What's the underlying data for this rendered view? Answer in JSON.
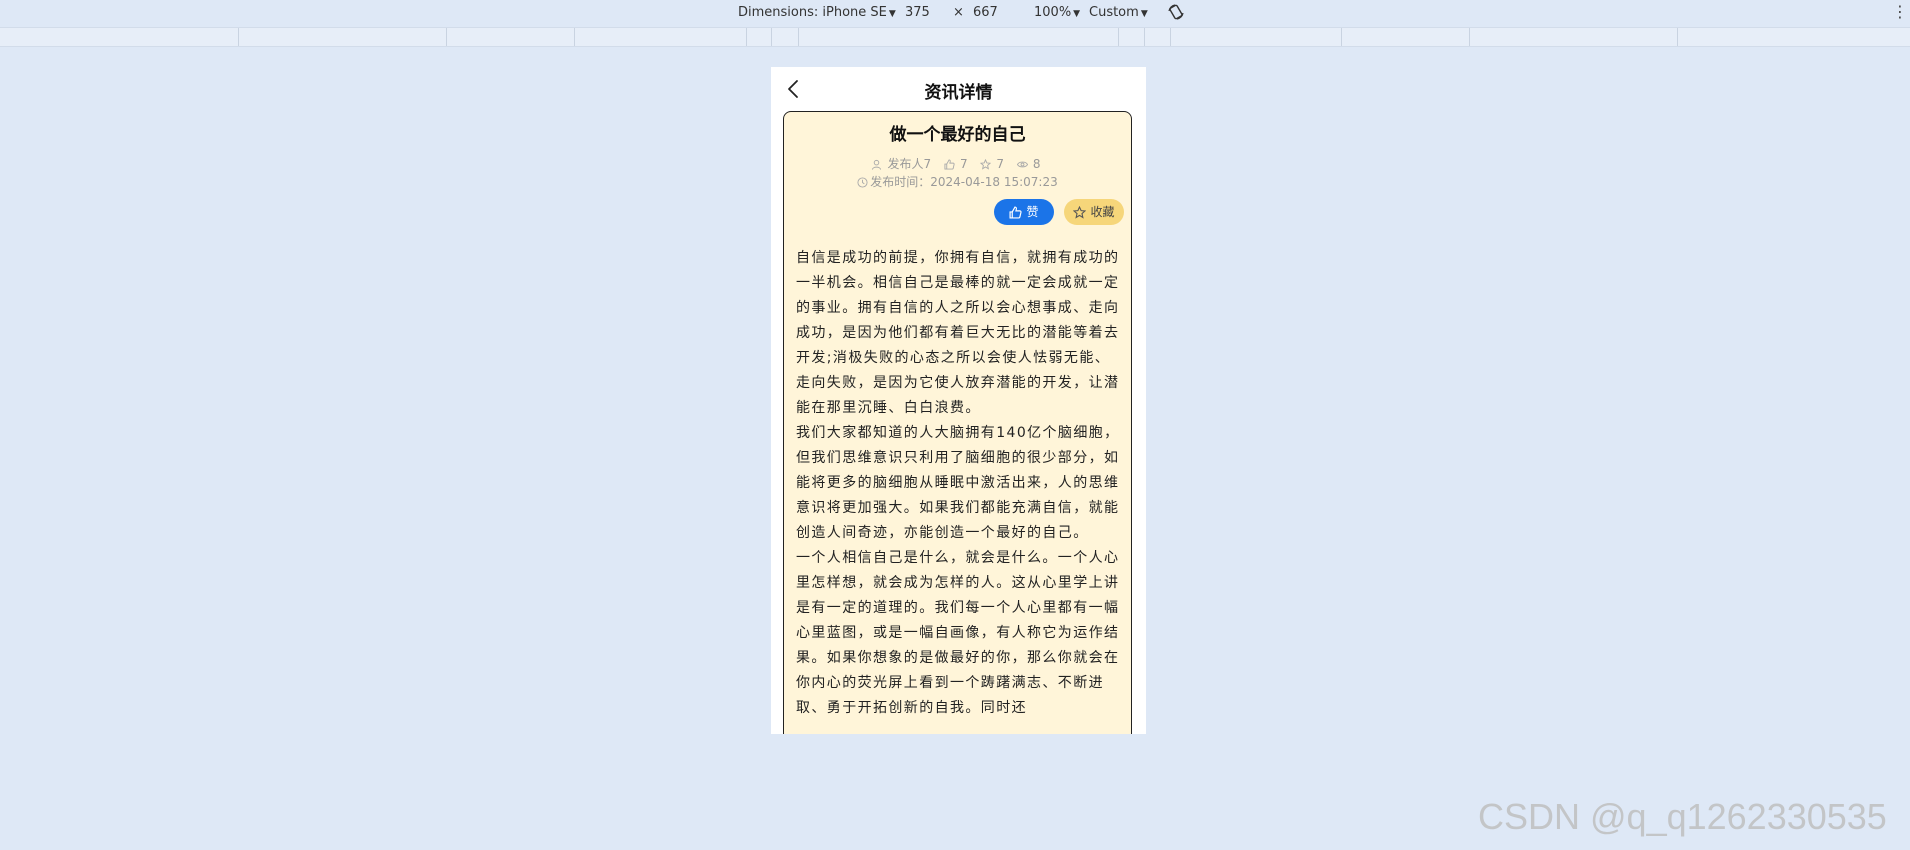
{
  "devtools": {
    "dimensions_label": "Dimensions: iPhone SE",
    "width": "375",
    "times": "×",
    "height": "667",
    "zoom": "100%",
    "throttle": "Custom"
  },
  "nav": {
    "title": "资讯详情"
  },
  "article": {
    "title": "做一个最好的自己",
    "publisher": "发布人7",
    "likes": "7",
    "favorites": "7",
    "views": "8",
    "publish_time": "发布时间：2024-04-18 15:07:23",
    "like_label": "赞",
    "fav_label": "收藏",
    "paragraphs": [
      "自信是成功的前提，你拥有自信，就拥有成功的一半机会。相信自己是最棒的就一定会成就一定的事业。拥有自信的人之所以会心想事成、走向成功，是因为他们都有着巨大无比的潜能等着去开发;消极失败的心态之所以会使人怯弱无能、走向失败，是因为它使人放弃潜能的开发，让潜能在那里沉睡、白白浪费。",
      "我们大家都知道的人大脑拥有140亿个脑细胞，但我们思维意识只利用了脑细胞的很少部分，如能将更多的脑细胞从睡眠中激活出来，人的思维意识将更加强大。如果我们都能充满自信，就能创造人间奇迹，亦能创造一个最好的自己。",
      "一个人相信自己是什么，就会是什么。一个人心里怎样想，就会成为怎样的人。这从心里学上讲是有一定的道理的。我们每一个人心里都有一幅心里蓝图，或是一幅自画像，有人称它为运作结果。如果你想象的是做最好的你，那么你就会在你内心的荧光屏上看到一个踌躇满志、不断进取、勇于开拓创新的自我。同时还"
    ]
  },
  "watermark": "CSDN @q_q1262330535"
}
